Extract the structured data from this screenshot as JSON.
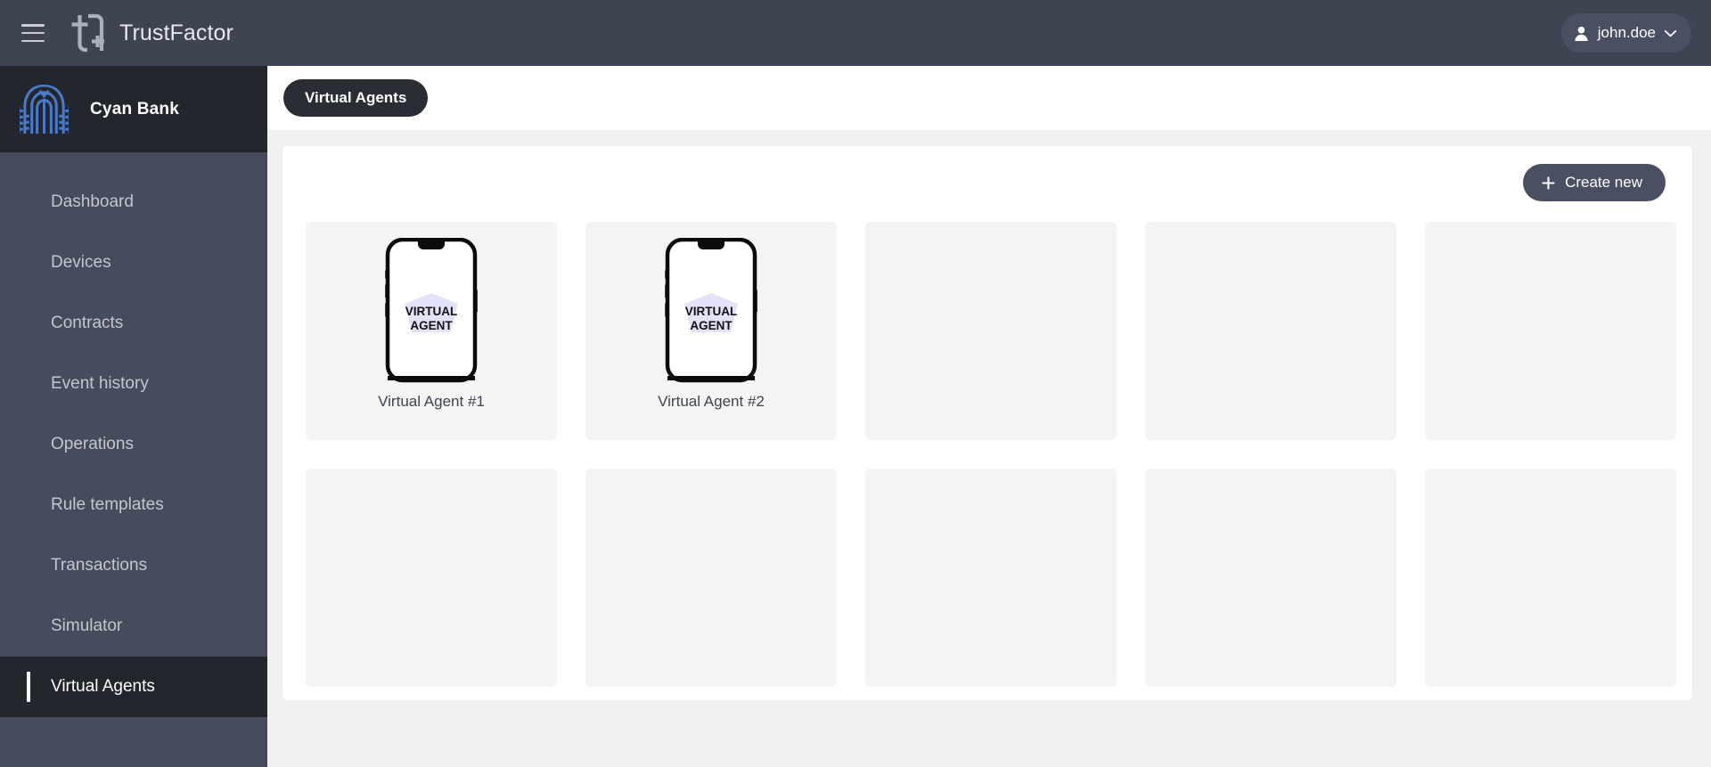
{
  "topbar": {
    "menu_icon": "hamburger-icon",
    "logo_icon": "trustfactor-logo-icon",
    "brand": "TrustFactor",
    "user": {
      "avatar_icon": "person-icon",
      "name": "john.doe",
      "chevron_icon": "chevron-down-icon"
    }
  },
  "sidebar": {
    "org": {
      "logo_icon": "cyan-bank-logo-icon",
      "name": "Cyan Bank"
    },
    "items": [
      {
        "label": "Dashboard",
        "active": false
      },
      {
        "label": "Devices",
        "active": false
      },
      {
        "label": "Contracts",
        "active": false
      },
      {
        "label": "Event history",
        "active": false
      },
      {
        "label": "Operations",
        "active": false
      },
      {
        "label": "Rule templates",
        "active": false
      },
      {
        "label": "Transactions",
        "active": false
      },
      {
        "label": "Simulator",
        "active": false
      },
      {
        "label": "Virtual Agents",
        "active": true
      }
    ]
  },
  "page": {
    "title": "Virtual Agents",
    "create_button": {
      "label": "Create new",
      "icon": "plus-icon"
    },
    "agent_screen_text_line1": "VIRTUAL",
    "agent_screen_text_line2": "AGENT",
    "cards": [
      {
        "label": "Virtual Agent #1",
        "empty": false
      },
      {
        "label": "Virtual Agent #2",
        "empty": false
      },
      {
        "label": "",
        "empty": true
      },
      {
        "label": "",
        "empty": true
      },
      {
        "label": "",
        "empty": true
      },
      {
        "label": "",
        "empty": true
      },
      {
        "label": "",
        "empty": true
      },
      {
        "label": "",
        "empty": true
      },
      {
        "label": "",
        "empty": true
      },
      {
        "label": "",
        "empty": true
      }
    ]
  },
  "colors": {
    "topbar_bg": "#3f4453",
    "sidebar_bg": "#474c5c",
    "sidebar_header_bg": "#24262e",
    "active_item_bg": "#24262e",
    "pill_bg": "#2b2d35",
    "button_bg": "#4a5061",
    "card_bg": "#f4f4f4",
    "page_bg": "#f0f0f0",
    "panel_bg": "#ffffff",
    "bank_logo": "#4a7ac7",
    "agent_badge": "#e2e2f8"
  }
}
